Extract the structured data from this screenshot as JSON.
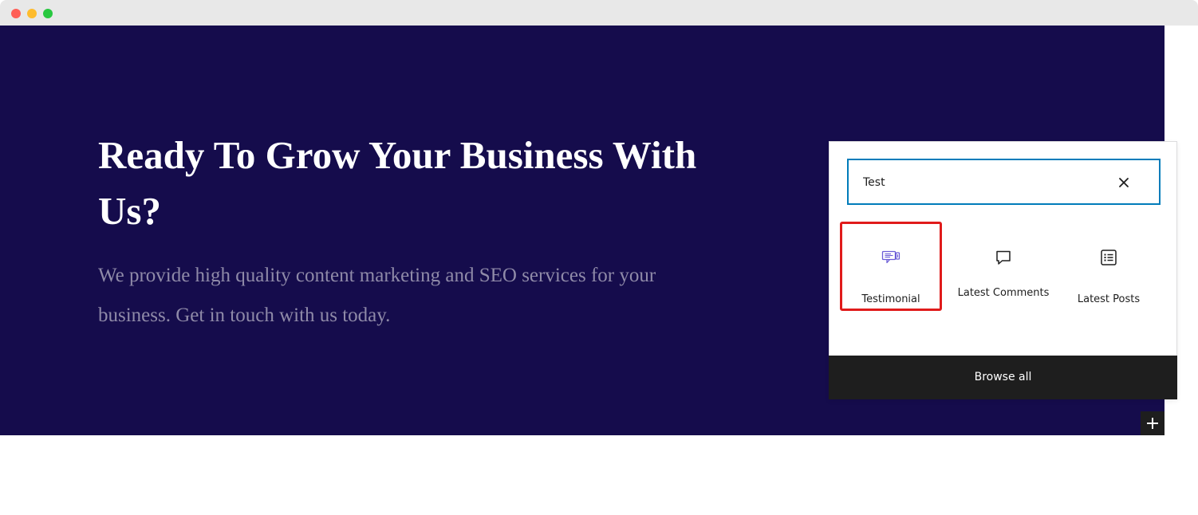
{
  "hero": {
    "title": "Ready To Grow Your Business With Us?",
    "description": "We provide high quality content marketing and SEO services for your business. Get in touch with us today."
  },
  "inserter": {
    "search": {
      "value": "Test",
      "clear_icon": "close-icon"
    },
    "blocks": [
      {
        "label": "Testimonial",
        "icon": "testimonial-icon",
        "selected": true
      },
      {
        "label": "Latest Comments",
        "icon": "comment-icon",
        "selected": false
      },
      {
        "label": "Latest Posts",
        "icon": "post-list-icon",
        "selected": false
      }
    ],
    "browse_all_label": "Browse all"
  },
  "add_block": {
    "icon": "plus-icon"
  },
  "colors": {
    "hero_background": "#150c4c",
    "hero_text_muted": "#8f8aa8",
    "search_focus_border": "#007cba",
    "highlight_border": "#e01b1b",
    "testimonial_icon": "#6b5cd6",
    "dark_button": "#1e1e1e"
  }
}
